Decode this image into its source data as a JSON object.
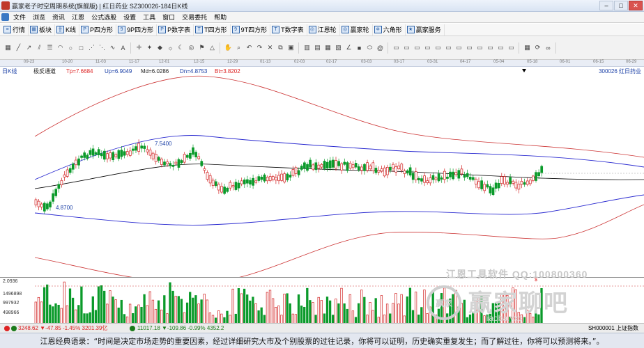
{
  "window": {
    "title": "赢家老子时空周期系统(旗舰版) | 红日药业  SZ300026-184日K线"
  },
  "menu": [
    "文件",
    "浏览",
    "资讯",
    "江恩",
    "公式选股",
    "设置",
    "工具",
    "窗口",
    "交易委托",
    "帮助"
  ],
  "toolbar": [
    "行情",
    "板块",
    "K线",
    "P四方形",
    "9P四方形",
    "P数字表",
    "T四方形",
    "9T四方形",
    "T数字表",
    "江恩轮",
    "赢家轮",
    "六角形",
    "赢家服务"
  ],
  "date_ticks": [
    "09-23",
    "10-20",
    "11-03",
    "11-17",
    "12-01",
    "12-15",
    "12-29",
    "01-13",
    "02-03",
    "02-17",
    "03-03",
    "03-17",
    "03-31",
    "04-17",
    "05-04",
    "05-18",
    "06-01",
    "06-15",
    "06-29"
  ],
  "chart_info": {
    "period": "日K线",
    "indicator": "极反通道",
    "tp": "Tp=7.6684",
    "up": "Up=6.9049",
    "md": "Md=6.0286",
    "dn": "Dn=4.8753",
    "bt": "Bt=3.8202",
    "stock": "300026  红日药业"
  },
  "annotations": {
    "high": "7.5400",
    "low": "4.8700"
  },
  "volume_axis": [
    "2.0936",
    "1496898",
    "997932",
    "498966"
  ],
  "volume_marker": "$",
  "status": {
    "sh": "3248.62 ▼-47.85 -1.45% 3201.39亿",
    "sz": "11017.18 ▼-109.86 -0.99% 4352.2",
    "right": "SH000001 上证指数"
  },
  "watermark": {
    "line1": "江恩工具软件  QQ:100800360",
    "logo": "赢家",
    "main": "赢家聊吧",
    "sub": "liaoba.yxcj"
  },
  "quote": "江恩经典语录：“时间是决定市场走势的重要因素，经过详细研究大市及个别股票的过往记录，你将可以证明，历史确实重复发生；而了解过往，你将可以预测将来。”。",
  "colors": {
    "up": "#d22222",
    "down": "#0a9a2a",
    "channel_outer": "#cc3333",
    "channel_inner": "#2a2ad0",
    "mid": "#000000"
  },
  "chart_data": {
    "type": "candlestick",
    "symbol": "300026",
    "name": "红日药业",
    "lines": {
      "Tp": 7.6684,
      "Up": 6.9049,
      "Md": 6.0286,
      "Dn": 4.8753,
      "Bt": 3.8202
    },
    "marked_high": 7.54,
    "marked_low": 4.87
  }
}
